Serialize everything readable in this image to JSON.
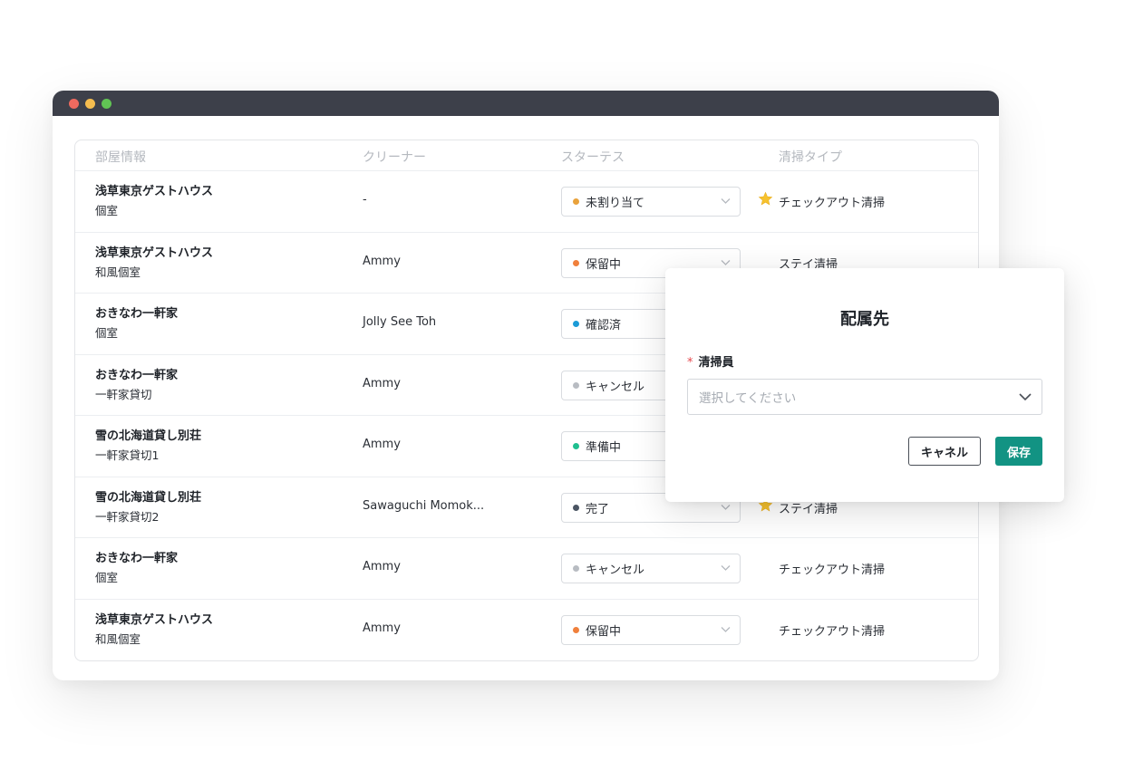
{
  "window": {
    "traffic_lights": [
      "#ee6a5f",
      "#f5bd4f",
      "#61c454"
    ]
  },
  "table": {
    "headers": {
      "room": "部屋情報",
      "cleaner": "クリーナー",
      "status": "スターテス",
      "cleaning_type": "清掃タイプ"
    },
    "rows": [
      {
        "room_name": "浅草東京ゲストハウス",
        "room_type": "個室",
        "cleaner": "-",
        "status": "未割り当て",
        "status_color": "#e9a23b",
        "cleaning_type": "チェックアウト清掃",
        "starred": true
      },
      {
        "room_name": "浅草東京ゲストハウス",
        "room_type": "和風個室",
        "cleaner": "Ammy",
        "status": "保留中",
        "status_color": "#f0803c",
        "cleaning_type": "ステイ清掃",
        "starred": false
      },
      {
        "room_name": "おきなわ一軒家",
        "room_type": "個室",
        "cleaner": "Jolly See Toh",
        "status": "確認済",
        "status_color": "#1b9bd7",
        "cleaning_type": "",
        "starred": false
      },
      {
        "room_name": "おきなわ一軒家",
        "room_type": "一軒家貸切",
        "cleaner": "Ammy",
        "status": "キャンセル",
        "status_color": "#b8bcc2",
        "cleaning_type": "",
        "starred": false
      },
      {
        "room_name": "雪の北海道貸し別荘",
        "room_type": "一軒家貸切1",
        "cleaner": "Ammy",
        "status": "準備中",
        "status_color": "#1fbf8f",
        "cleaning_type": "",
        "starred": false
      },
      {
        "room_name": "雪の北海道貸し別荘",
        "room_type": "一軒家貸切2",
        "cleaner": "Sawaguchi Momok...",
        "status": "完了",
        "status_color": "#4b5563",
        "cleaning_type": "ステイ清掃",
        "starred": true
      },
      {
        "room_name": "おきなわ一軒家",
        "room_type": "個室",
        "cleaner": "Ammy",
        "status": "キャンセル",
        "status_color": "#b8bcc2",
        "cleaning_type": "チェックアウト清掃",
        "starred": false
      },
      {
        "room_name": "浅草東京ゲストハウス",
        "room_type": "和風個室",
        "cleaner": "Ammy",
        "status": "保留中",
        "status_color": "#f0803c",
        "cleaning_type": "チェックアウト清掃",
        "starred": false
      }
    ]
  },
  "popup": {
    "title": "配属先",
    "required_mark": "*",
    "field_label": "清掃員",
    "field_placeholder": "選択してください",
    "cancel_label": "キャネル",
    "save_label": "保存",
    "accent_color": "#129383"
  },
  "icons": {
    "star": "star-icon",
    "chevron": "chevron-down-icon"
  }
}
